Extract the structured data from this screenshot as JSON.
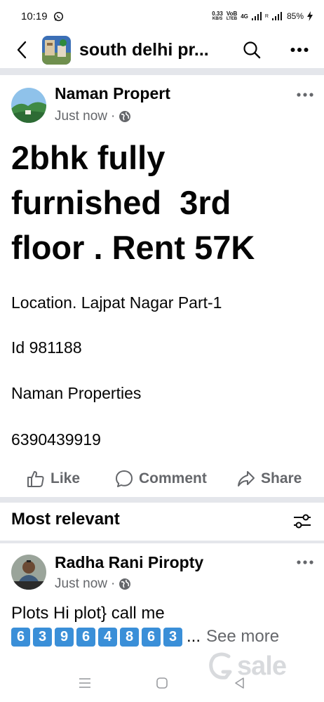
{
  "status_bar": {
    "time": "10:19",
    "speed_value": "0.33",
    "speed_unit": "KB/S",
    "volte_top": "VoB",
    "volte_bottom": "LTEB",
    "network": "4G",
    "sim2": "R",
    "battery": "85%",
    "icons": [
      "whatsapp-icon",
      "signal-icon",
      "battery-charging-icon"
    ]
  },
  "header": {
    "title": "south delhi pr...",
    "icons": [
      "back-arrow-icon",
      "search-icon",
      "more-horizontal-icon"
    ]
  },
  "post": {
    "author": "Naman Propert",
    "time": "Just now",
    "dot": "·",
    "headline": "2bhk fully\nfurnished  3rd\nfloor . Rent 57K",
    "lines": {
      "location": "Location. Lajpat Nagar Part-1",
      "id": "Id 981188",
      "company": "Naman Properties",
      "phone": "6390439919"
    }
  },
  "actions": {
    "like": "Like",
    "comment": "Comment",
    "share": "Share"
  },
  "comments_section": {
    "sort_label": "Most relevant"
  },
  "comment": {
    "author": "Radha Rani Piropty",
    "time": "Just now",
    "dot": "·",
    "text": "Plots Hi plot} call me",
    "digits": [
      "6",
      "3",
      "9",
      "6",
      "4",
      "8",
      "6",
      "3"
    ],
    "ellipsis": "...",
    "see_more": "See more"
  },
  "watermark": {
    "text": "sale"
  },
  "colors": {
    "text_primary": "#050505",
    "text_secondary": "#65676b",
    "separator": "#c9ccd1",
    "keycap": "#3a8fd8"
  }
}
